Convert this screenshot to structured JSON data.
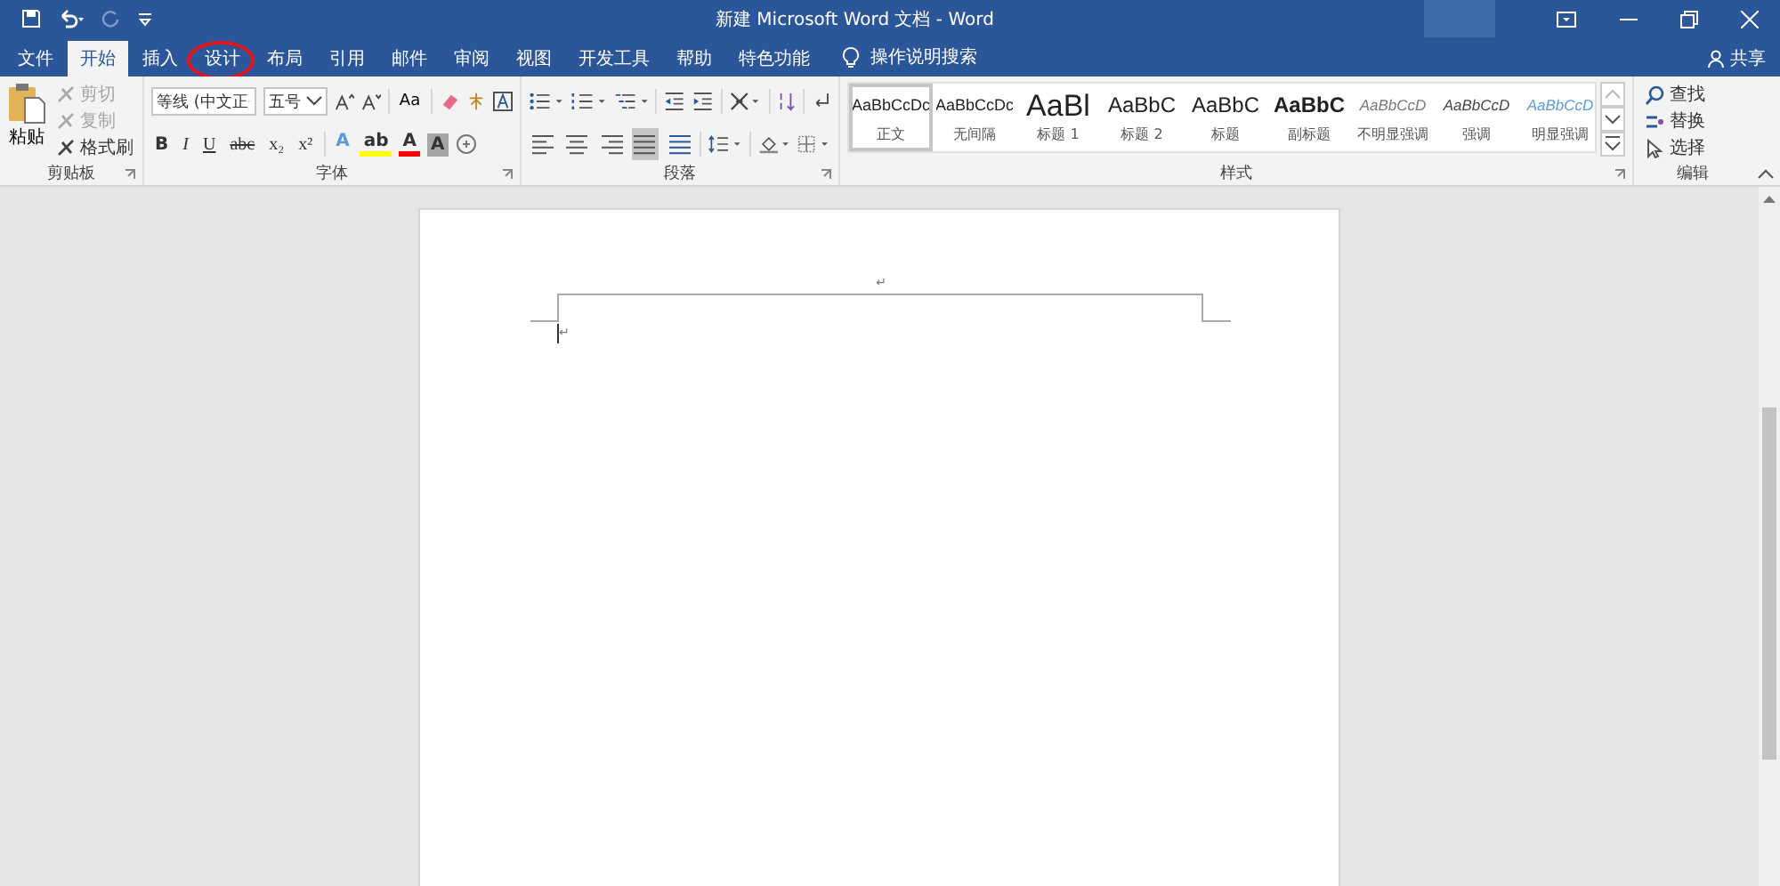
{
  "window": {
    "title": "新建 Microsoft Word 文档 - Word"
  },
  "tabs": [
    {
      "label": "文件",
      "selected": false,
      "circled": false
    },
    {
      "label": "开始",
      "selected": true,
      "circled": false
    },
    {
      "label": "插入",
      "selected": false,
      "circled": false
    },
    {
      "label": "设计",
      "selected": false,
      "circled": true
    },
    {
      "label": "布局",
      "selected": false,
      "circled": false
    },
    {
      "label": "引用",
      "selected": false,
      "circled": false
    },
    {
      "label": "邮件",
      "selected": false,
      "circled": false
    },
    {
      "label": "审阅",
      "selected": false,
      "circled": false
    },
    {
      "label": "视图",
      "selected": false,
      "circled": false
    },
    {
      "label": "开发工具",
      "selected": false,
      "circled": false
    },
    {
      "label": "帮助",
      "selected": false,
      "circled": false
    },
    {
      "label": "特色功能",
      "selected": false,
      "circled": false
    }
  ],
  "tell_me": "操作说明搜索",
  "share": "共享",
  "clipboard": {
    "label": "剪贴板",
    "paste": "粘贴",
    "items": [
      {
        "label": "剪切",
        "disabled": true
      },
      {
        "label": "复制",
        "disabled": true
      },
      {
        "label": "格式刷",
        "disabled": false
      }
    ]
  },
  "font": {
    "label": "字体",
    "font_name": "等线 (中文正",
    "font_size": "五号",
    "case_button": "Aa",
    "format_buttons": [
      {
        "label": "B",
        "kind": "bold"
      },
      {
        "label": "I",
        "kind": "italic"
      },
      {
        "label": "U",
        "kind": "underline"
      },
      {
        "label": "abc",
        "kind": "strike"
      },
      {
        "label": "x₂",
        "kind": "plain"
      },
      {
        "label": "x²",
        "kind": "plain"
      }
    ],
    "color_buttons": [
      {
        "label": "A",
        "kind": "effect",
        "color": "#5b9bd5"
      },
      {
        "label": "ab",
        "kind": "highlight",
        "color": "#ffff00"
      },
      {
        "label": "A",
        "kind": "fontcolor",
        "color": "#ff0000"
      },
      {
        "label": "A",
        "kind": "shading",
        "color": "#a6a6a6"
      }
    ]
  },
  "paragraph": {
    "label": "段落",
    "alignments": [
      {
        "selected": false
      },
      {
        "selected": false
      },
      {
        "selected": false
      },
      {
        "selected": true
      },
      {
        "selected": false
      }
    ]
  },
  "styles": {
    "label": "样式",
    "items": [
      {
        "preview": "AaBbCcDc",
        "name": "正文",
        "kind": "normal",
        "selected": true
      },
      {
        "preview": "AaBbCcDc",
        "name": "无间隔",
        "kind": "normal",
        "selected": false
      },
      {
        "preview": "AaBl",
        "name": "标题 1",
        "kind": "heading1",
        "selected": false
      },
      {
        "preview": "AaBbC",
        "name": "标题 2",
        "kind": "heading2",
        "selected": false
      },
      {
        "preview": "AaBbC",
        "name": "标题",
        "kind": "heading2",
        "selected": false
      },
      {
        "preview": "AaBbC",
        "name": "副标题",
        "kind": "subtitle",
        "selected": false
      },
      {
        "preview": "AaBbCcD",
        "name": "不明显强调",
        "kind": "subtle",
        "selected": false
      },
      {
        "preview": "AaBbCcD",
        "name": "强调",
        "kind": "emphasis",
        "selected": false
      },
      {
        "preview": "AaBbCcD",
        "name": "明显强调",
        "kind": "intense",
        "selected": false
      }
    ]
  },
  "editing": {
    "label": "编辑",
    "items": [
      {
        "label": "查找"
      },
      {
        "label": "替换"
      },
      {
        "label": "选择"
      }
    ]
  },
  "document": {
    "header_mark": "↵",
    "body_mark": "↵"
  }
}
